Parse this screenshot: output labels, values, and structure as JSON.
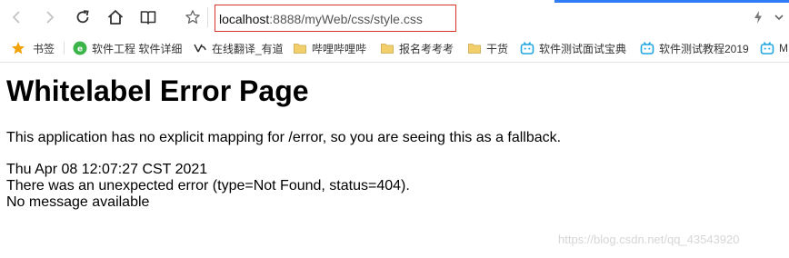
{
  "browser": {
    "url_host": "localhost",
    "url_rest": ":8888/myWeb/css/style.css",
    "accent_color": "#2f7cf6",
    "highlight_color": "#d9342b",
    "toolbar_icons": [
      "back-icon",
      "forward-icon",
      "reload-icon",
      "home-icon",
      "reader-icon",
      "star-icon",
      "lightning-icon",
      "chevron-down-icon"
    ]
  },
  "bookmarks": [
    {
      "label": "书签",
      "icon": "star-icon"
    },
    {
      "label": "软件工程 软件详细",
      "icon": "green-site-icon"
    },
    {
      "label": "在线翻译_有道",
      "icon": "youdao-icon"
    },
    {
      "label": "哔哩哔哩哔",
      "icon": "folder-icon"
    },
    {
      "label": "报名考考考",
      "icon": "folder-icon"
    },
    {
      "label": "干货",
      "icon": "folder-icon"
    },
    {
      "label": "软件测试面试宝典",
      "icon": "bilibili-icon"
    },
    {
      "label": "软件测试教程2019",
      "icon": "bilibili-icon"
    },
    {
      "label": "M",
      "icon": "bilibili-icon"
    }
  ],
  "page": {
    "title": "Whitelabel Error Page",
    "explanation": "This application has no explicit mapping for /error, so you are seeing this as a fallback.",
    "timestamp": "Thu Apr 08 12:07:27 CST 2021",
    "error_line": "There was an unexpected error (type=Not Found, status=404).",
    "message_line": "No message available"
  },
  "watermark": "https://blog.csdn.net/qq_43543920"
}
